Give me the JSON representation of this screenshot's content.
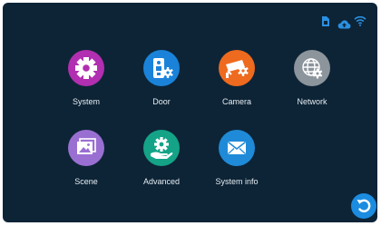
{
  "apps": [
    {
      "label": "System",
      "icon": "gear-icon",
      "color": "#b12fb0"
    },
    {
      "label": "Door",
      "icon": "door-phone-icon",
      "color": "#1a83d9"
    },
    {
      "label": "Camera",
      "icon": "cctv-camera-icon",
      "color": "#ee6a1e"
    },
    {
      "label": "Network",
      "icon": "network-globe-icon",
      "color": "#8c949c"
    },
    {
      "label": "Scene",
      "icon": "scene-picture-icon",
      "color": "#9a6fd2"
    },
    {
      "label": "Advanced",
      "icon": "advanced-gear-hand-icon",
      "color": "#14a387"
    },
    {
      "label": "System info",
      "icon": "envelope-icon",
      "color": "#1f8ad8"
    }
  ],
  "status_icons": [
    "sim-card-icon",
    "cloud-upload-icon",
    "wifi-icon"
  ],
  "colors": {
    "background": "#0d2436",
    "status_icon": "#2b8fe0",
    "back_button": "#1c8ce0"
  }
}
